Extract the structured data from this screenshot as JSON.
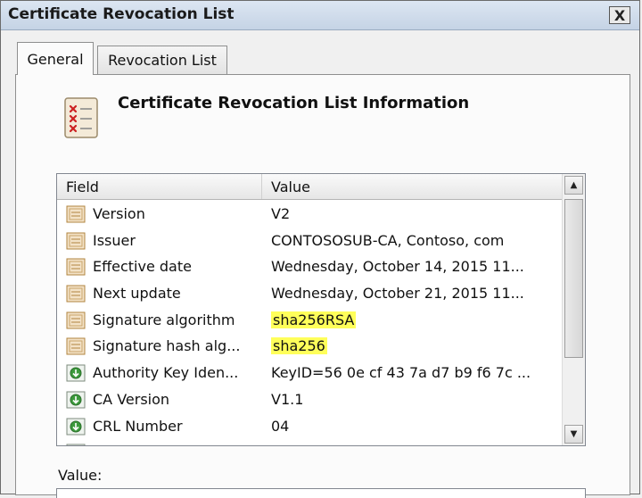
{
  "window": {
    "title": "Certificate Revocation List",
    "close_glyph": "X"
  },
  "tabs": [
    {
      "label": "General",
      "active": true
    },
    {
      "label": "Revocation List",
      "active": false
    }
  ],
  "info": {
    "title": "Certificate Revocation List Information",
    "icon": "crl-document-icon"
  },
  "list": {
    "columns": [
      "Field",
      "Value"
    ],
    "rows": [
      {
        "field": "Version",
        "value": "V2",
        "icon": "property-icon",
        "highlight": false
      },
      {
        "field": "Issuer",
        "value": "CONTOSOSUB-CA, Contoso, com",
        "icon": "property-icon",
        "highlight": false
      },
      {
        "field": "Effective date",
        "value": "Wednesday, October 14, 2015 11...",
        "icon": "property-icon",
        "highlight": false
      },
      {
        "field": "Next update",
        "value": "Wednesday, October 21, 2015 11...",
        "icon": "property-icon",
        "highlight": false
      },
      {
        "field": "Signature algorithm",
        "value": "sha256RSA",
        "icon": "property-icon",
        "highlight": true
      },
      {
        "field": "Signature hash alg...",
        "value": "sha256",
        "icon": "property-icon",
        "highlight": true
      },
      {
        "field": "Authority Key Iden...",
        "value": "KeyID=56 0e cf 43 7a d7 b9 f6 7c ...",
        "icon": "extension-icon",
        "highlight": false
      },
      {
        "field": "CA Version",
        "value": "V1.1",
        "icon": "extension-icon",
        "highlight": false
      },
      {
        "field": "CRL Number",
        "value": "04",
        "icon": "extension-icon",
        "highlight": false
      },
      {
        "field": "",
        "value": "",
        "icon": "extension-icon",
        "highlight": false
      }
    ]
  },
  "value_section": {
    "label": "Value:"
  },
  "colors": {
    "highlight": "#ffff5a",
    "titlebar": "#c5d3e5"
  }
}
